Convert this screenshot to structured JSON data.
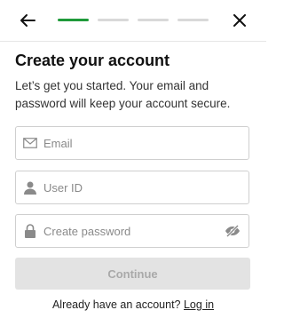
{
  "header": {
    "back_icon": "arrow-left-icon",
    "close_icon": "close-icon",
    "progress": {
      "current_step": 1,
      "total_steps": 4,
      "active_color": "#1f9a3a",
      "inactive_color": "#d9d9d9"
    }
  },
  "main": {
    "title": "Create your account",
    "subtitle": "Let’s get you started. Your email and password will keep your account secure."
  },
  "form": {
    "email": {
      "placeholder": "Email",
      "value": "",
      "icon": "envelope-icon"
    },
    "user_id": {
      "placeholder": "User ID",
      "value": "",
      "icon": "person-icon"
    },
    "password": {
      "placeholder": "Create password",
      "value": "",
      "icon": "lock-icon",
      "toggle_icon": "eye-slash-icon"
    },
    "continue_label": "Continue"
  },
  "footer": {
    "prompt": "Already have an account?",
    "login_link": "Log in"
  }
}
